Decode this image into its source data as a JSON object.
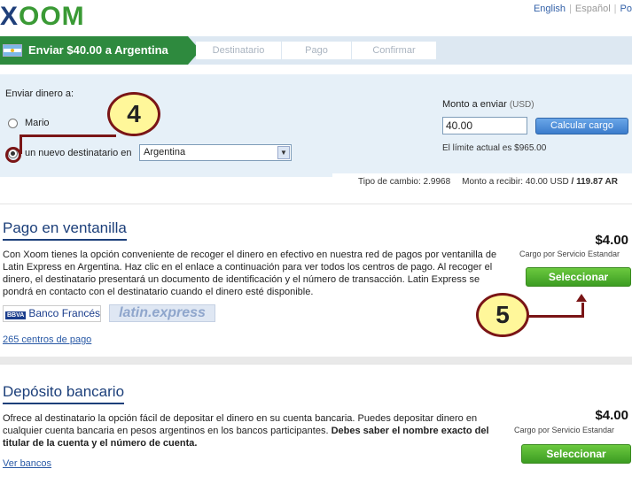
{
  "brand": {
    "logo_x": "X",
    "logo_rest": "OOM",
    "accent": "#2e8a3e",
    "badge_color": "#fff79a"
  },
  "languages": {
    "english": "English",
    "espanol": "Español",
    "other": "Po"
  },
  "steps": {
    "active": "Enviar $40.00 a Argentina",
    "destinatario": "Destinatario",
    "pago": "Pago",
    "confirmar": "Confirmar",
    "flag_icon": "argentina-flag-icon"
  },
  "send": {
    "title": "Enviar dinero a:",
    "recipient_existing": "Mario",
    "recipient_new": "un nuevo destinatario en",
    "country_selected": "Argentina"
  },
  "amount": {
    "label": "Monto a enviar",
    "currency_note": "(USD)",
    "value": "40.00",
    "calc_button": "Calcular cargo",
    "limit_text": "El límite actual es $965.00"
  },
  "rate": {
    "exchange": "Tipo de cambio: 2.9968",
    "receive": "Monto a recibir: 40.00 USD",
    "slash": "/",
    "receive_local": "119.87 AR"
  },
  "annotations": {
    "step4": "4",
    "step5": "5"
  },
  "pickup": {
    "title": "Pago en ventanilla",
    "description": "Con Xoom tienes la opción conveniente de recoger el dinero en efectivo en nuestra red de pagos por ventanilla de Latin Express en Argentina. Haz clic en el enlace a continuación para ver todos los centros de pago. Al recoger el dinero, el destinatario presentará un documento de identificación y el número de transacción. Latin Express se pondrá en contacto con el destinatario cuando el dinero esté disponible.",
    "bbva_mark": "BBVA",
    "bbva_name": "Banco Francés",
    "latin_logo": "latin.express",
    "centers_link": "265 centros de pago",
    "price": "$4.00",
    "price_note": "Cargo por Servicio Estandar",
    "select_button": "Seleccionar"
  },
  "deposit": {
    "title": "Depósito bancario",
    "description_plain": "Ofrece al destinatario la opción fácil de depositar el dinero en su cuenta bancaria. Puedes depositar dinero en cualquier cuenta bancaria en pesos argentinos en los bancos participantes.",
    "description_bold": "Debes saber el nombre exacto del titular de la cuenta y el número de cuenta.",
    "banks_link": "Ver bancos",
    "price": "$4.00",
    "price_note": "Cargo por Servicio Estandar",
    "select_button": "Seleccionar"
  }
}
